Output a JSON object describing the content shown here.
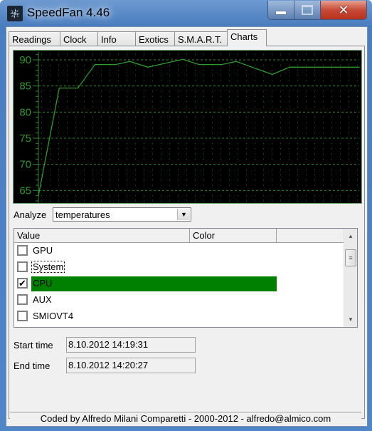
{
  "window": {
    "title": "SpeedFan 4.46",
    "icon": "fan-icon",
    "controls": {
      "minimize": "minimize-icon",
      "maximize": "maximize-icon",
      "close": "close-icon"
    }
  },
  "tabs": [
    {
      "label": "Readings",
      "active": false
    },
    {
      "label": "Clock",
      "active": false
    },
    {
      "label": "Info",
      "active": false
    },
    {
      "label": "Exotics",
      "active": false
    },
    {
      "label": "S.M.A.R.T.",
      "active": false
    },
    {
      "label": "Charts",
      "active": true
    }
  ],
  "chart_data": {
    "type": "line",
    "title": "",
    "xlabel": "",
    "ylabel": "",
    "ylim": [
      63,
      91.5
    ],
    "yticks": [
      "90",
      "85",
      "80",
      "75",
      "70",
      "65"
    ],
    "grid": true,
    "background": "#000000",
    "line_color": "#2e9a2e",
    "series": [
      {
        "name": "CPU",
        "x": [
          0,
          6.5,
          12.3,
          17.6,
          24.1,
          28.5,
          34.1,
          45.0,
          50.1,
          57.2,
          61.6,
          72.9,
          78.3,
          100
        ],
        "values": [
          64,
          84.6,
          84.6,
          89.1,
          89.1,
          89.7,
          88.6,
          90.1,
          89.1,
          89.1,
          89.7,
          87.2,
          88.6,
          88.6
        ]
      }
    ]
  },
  "analyze": {
    "label": "Analyze",
    "selected": "temperatures"
  },
  "list": {
    "columns": [
      "Value",
      "Color",
      ""
    ],
    "items": [
      {
        "label": "GPU",
        "checked": false,
        "color": ""
      },
      {
        "label": "System",
        "checked": false,
        "color": "",
        "focused": true
      },
      {
        "label": "CPU",
        "checked": true,
        "color": "#008000"
      },
      {
        "label": "AUX",
        "checked": false,
        "color": ""
      },
      {
        "label": "SMIOVT4",
        "checked": false,
        "color": ""
      }
    ],
    "check_glyph": "✔"
  },
  "times": {
    "start_label": "Start time",
    "start_value": "8.10.2012 14:19:31",
    "end_label": "End time",
    "end_value": "8.10.2012 14:20:27"
  },
  "footer": {
    "text": "Coded by Alfredo Milani Comparetti - 2000-2012 - alfredo@almico.com"
  }
}
